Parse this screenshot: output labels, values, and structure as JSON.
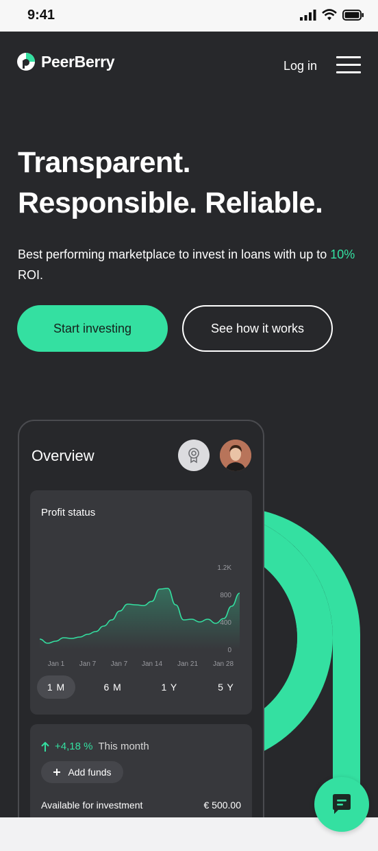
{
  "status_bar": {
    "time": "9:41"
  },
  "nav": {
    "logo_text": "PeerBerry",
    "login_label": "Log in"
  },
  "hero": {
    "title_line1": "Transparent.",
    "title_line2": "Responsible. Reliable.",
    "subtitle_before": "Best performing marketplace to invest in loans with up to ",
    "subtitle_accent": "10%",
    "subtitle_after": " ROI.",
    "primary_button": "Start investing",
    "secondary_button": "See how it works"
  },
  "overview": {
    "title": "Overview",
    "profit_card": {
      "title": "Profit status",
      "periods": [
        "1 M",
        "6 M",
        "1 Y",
        "5 Y"
      ],
      "active_period": "1 M"
    },
    "funds_card": {
      "growth_value": "+4,18 %",
      "growth_label": "This month",
      "add_funds_label": "Add funds",
      "available_label": "Available for investment",
      "available_value": "€ 500.00"
    }
  },
  "colors": {
    "accent": "#34e0a1",
    "background": "#27282b",
    "card": "#37383c"
  },
  "icons": [
    "logo-icon",
    "signal-icon",
    "wifi-icon",
    "battery-icon",
    "menu-icon",
    "award-icon",
    "arrow-up-icon",
    "plus-icon",
    "chat-icon"
  ],
  "chart_data": {
    "type": "area",
    "x": [
      0,
      1,
      2,
      3,
      4,
      5,
      6,
      7,
      8,
      9,
      10,
      11,
      12,
      13,
      14,
      15,
      16,
      17,
      18,
      19,
      20,
      21,
      22,
      23,
      24,
      25,
      26,
      27,
      28,
      29
    ],
    "values": [
      150,
      90,
      120,
      170,
      160,
      180,
      220,
      260,
      340,
      430,
      560,
      660,
      650,
      640,
      700,
      880,
      890,
      650,
      430,
      440,
      400,
      440,
      380,
      450,
      630,
      820
    ],
    "x_tick_labels": [
      "Jan 1",
      "Jan 7",
      "Jan 7",
      "Jan 14",
      "Jan 21",
      "Jan 28"
    ],
    "y_tick_labels": [
      "1.2K",
      "800",
      "400",
      "0"
    ],
    "ylim": [
      0,
      1200
    ],
    "grid": false
  }
}
